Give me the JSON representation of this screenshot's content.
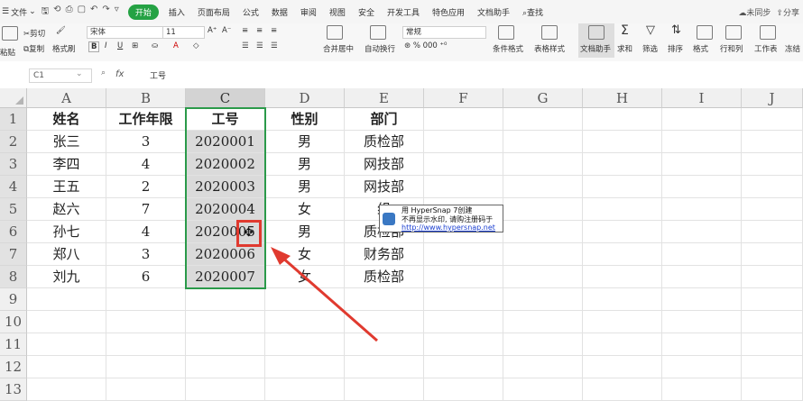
{
  "menubar": {
    "file": "文件",
    "start_pill": "开始",
    "tabs": [
      "插入",
      "页面布局",
      "公式",
      "数据",
      "审阅",
      "视图",
      "安全",
      "开发工具",
      "特色应用",
      "文档助手"
    ],
    "search": "查找",
    "sync": "未同步",
    "share": "分享"
  },
  "ribbon": {
    "paste": "粘贴",
    "cut": "剪切",
    "copy": "复制",
    "format_painter": "格式刷",
    "font_name": "宋体",
    "font_size": "11",
    "merge_center": "合并居中",
    "wrap_text": "自动换行",
    "number_format": "常规",
    "cond_format": "条件格式",
    "table_style": "表格样式",
    "doc_assistant": "文档助手",
    "sum": "求和",
    "filter": "筛选",
    "sort": "排序",
    "format": "格式",
    "row_col": "行和列",
    "worksheet": "工作表",
    "freeze": "冻结"
  },
  "formula_bar": {
    "name_box": "C1",
    "fx": "fx",
    "value": "工号"
  },
  "columns": [
    "A",
    "B",
    "C",
    "D",
    "E",
    "F",
    "G",
    "H",
    "I",
    "J"
  ],
  "rows": [
    "1",
    "2",
    "3",
    "4",
    "5",
    "6",
    "7",
    "8",
    "9",
    "10",
    "11",
    "12",
    "13"
  ],
  "table": {
    "headers": [
      "姓名",
      "工作年限",
      "工号",
      "性别",
      "部门"
    ],
    "data": [
      [
        "张三",
        "3",
        "2020001",
        "男",
        "质检部"
      ],
      [
        "李四",
        "4",
        "2020002",
        "男",
        "网技部"
      ],
      [
        "王五",
        "2",
        "2020003",
        "男",
        "网技部"
      ],
      [
        "赵六",
        "7",
        "2020004",
        "女",
        "组"
      ],
      [
        "孙七",
        "4",
        "2020005",
        "男",
        "质检部"
      ],
      [
        "郑八",
        "3",
        "2020006",
        "女",
        "财务部"
      ],
      [
        "刘九",
        "6",
        "2020007",
        "女",
        "质检部"
      ]
    ]
  },
  "watermark": {
    "line1": "用 HyperSnap 7创建",
    "line2": "不再显示水印, 请购注册码于",
    "line3": "http://www.hypersnap.net"
  },
  "colors": {
    "selection_border": "#2b9a4a",
    "annotation_red": "#e03a2f",
    "start_tab": "#25a244"
  }
}
